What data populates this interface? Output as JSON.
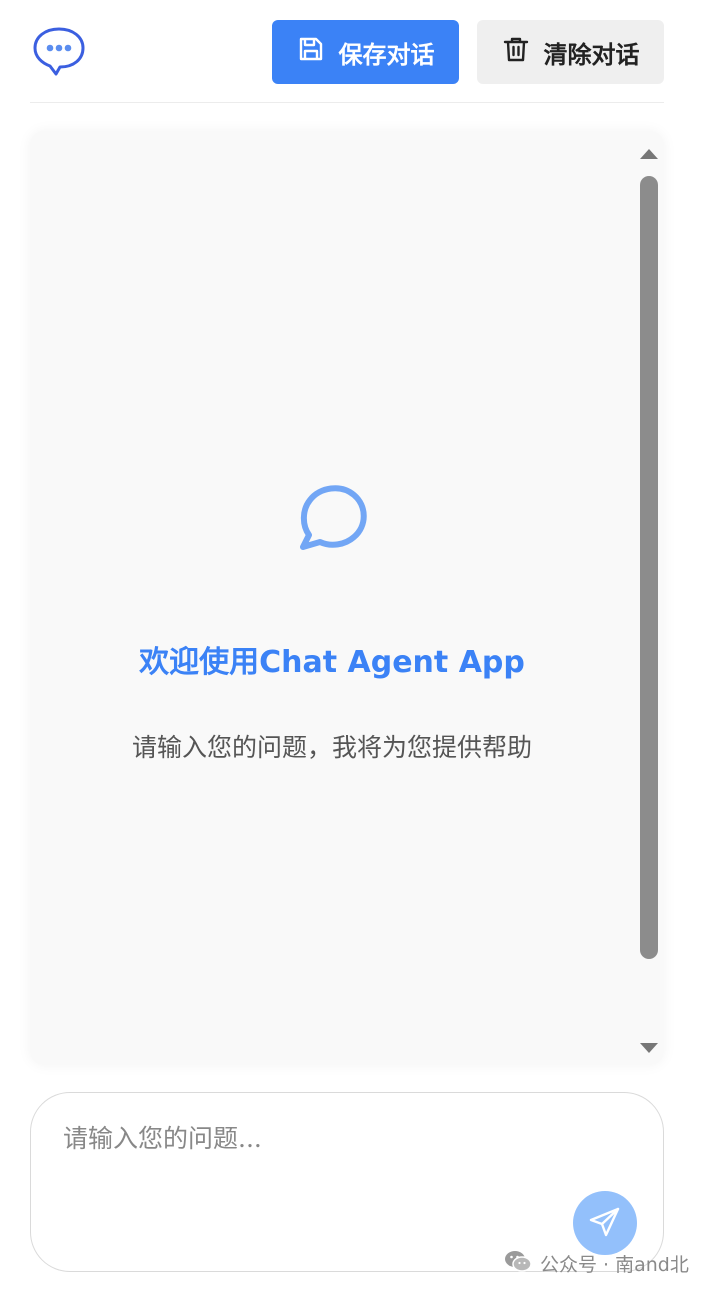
{
  "header": {
    "logo_icon": "chat-bubble-dots-icon",
    "save_label": "保存对话",
    "save_icon": "floppy-disk-icon",
    "clear_label": "清除对话",
    "clear_icon": "trash-icon"
  },
  "chat": {
    "welcome_icon": "message-circle-icon",
    "welcome_title": "欢迎使用Chat Agent App",
    "welcome_subtitle": "请输入您的问题，我将为您提供帮助"
  },
  "input": {
    "placeholder": "请输入您的问题...",
    "value": "",
    "send_icon": "send-icon"
  },
  "watermark": {
    "text": "公众号 · 南and北",
    "icon": "wechat-icon"
  },
  "colors": {
    "accent": "#3b82f6",
    "send_button": "#93c0fb",
    "panel_background": "#f9f9f9",
    "clear_button": "#efefef"
  }
}
